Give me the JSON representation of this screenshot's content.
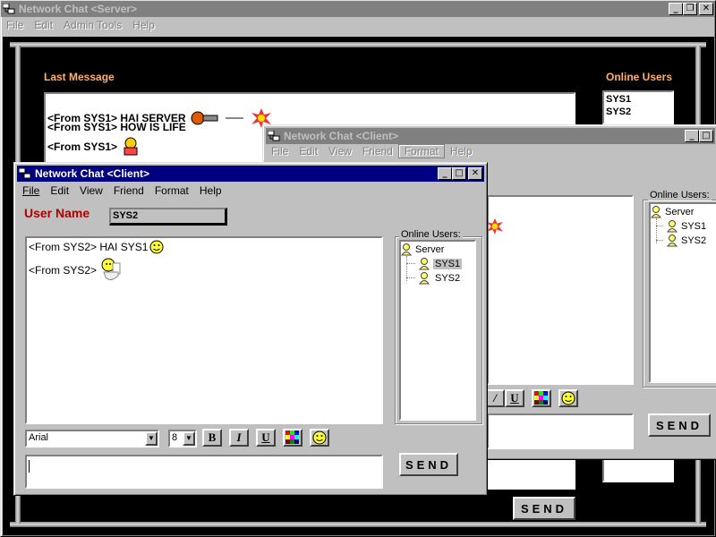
{
  "server": {
    "title": "Network Chat  <Server>",
    "menu": [
      "File",
      "Edit",
      "Admin Tools",
      "Help"
    ],
    "last_message_label": "Last Message",
    "online_users_label": "Online Users",
    "messages": [
      "<From SYS1> HAI SERVER",
      "<From SYS1> HOW IS LIFE",
      "<From SYS1>"
    ],
    "online_users": [
      "SYS1",
      "SYS2"
    ],
    "send_label": "SEND"
  },
  "client_back": {
    "title": "Network Chat <Client>",
    "menu": [
      "File",
      "Edit",
      "View",
      "Friend",
      "Format",
      "Help"
    ],
    "online_users_label": "Online Users:",
    "tree": {
      "root": "Server",
      "children": [
        "SYS1",
        "SYS2"
      ]
    },
    "send_label": "SEND"
  },
  "client_front": {
    "title": "Network Chat <Client>",
    "menu": [
      "File",
      "Edit",
      "View",
      "Friend",
      "Format",
      "Help"
    ],
    "user_name_label": "User Name",
    "user_name_value": "SYS2",
    "messages": [
      "<From SYS2> HAI SYS1",
      "<From SYS2>"
    ],
    "online_users_label": "Online Users:",
    "tree": {
      "root": "Server",
      "children": [
        "SYS1",
        "SYS2"
      ],
      "selected": "SYS1"
    },
    "font_value": "Arial",
    "size_value": "8",
    "bold_label": "B",
    "italic_label": "I",
    "underline_label": "U",
    "send_label": "SEND"
  },
  "colors": {
    "accent_red": "#b00000",
    "server_label": "#ffb070",
    "title_active": "#000080"
  }
}
